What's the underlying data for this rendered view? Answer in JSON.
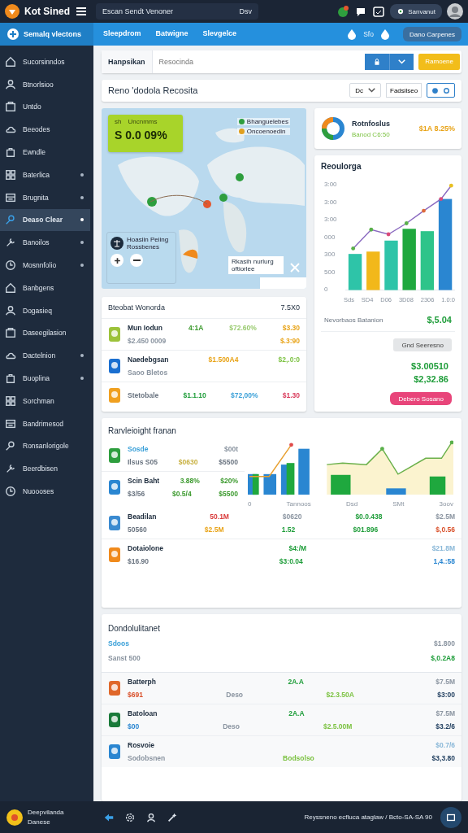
{
  "topbar": {
    "app_name": "Kot Sined",
    "search_text": "Escan Sendt Venoner",
    "search_badge": "Dsv",
    "account_button": "Sanvanut"
  },
  "navbar": {
    "workspace": "Semalq vlectons",
    "tabs": [
      {
        "label": "Sleepdrom",
        "selected": false
      },
      {
        "label": "Batwigne",
        "selected": false
      },
      {
        "label": "Slevgelce",
        "selected": false
      }
    ],
    "count": "Sfo",
    "action_button": "Dano Carpenes"
  },
  "sidebar": {
    "items": [
      {
        "label": "Sucorsinndos",
        "selected": false,
        "expandable": false
      },
      {
        "label": "Btnorlsioo",
        "selected": false,
        "expandable": false
      },
      {
        "label": "Untdo",
        "selected": false,
        "expandable": false
      },
      {
        "label": "Beeodes",
        "selected": false,
        "expandable": false
      },
      {
        "label": "Ewndle",
        "selected": false,
        "expandable": false
      },
      {
        "label": "Baterlica",
        "selected": false,
        "expandable": true
      },
      {
        "label": "Brugnita",
        "selected": false,
        "expandable": true
      },
      {
        "label": "Deaso Clear",
        "selected": true,
        "expandable": true
      },
      {
        "label": "Banoilos",
        "selected": false,
        "expandable": true
      },
      {
        "label": "Mosnnfolio",
        "selected": false,
        "expandable": true
      },
      {
        "label": "Banbgens",
        "selected": false,
        "expandable": false
      },
      {
        "label": "Dogasieq",
        "selected": false,
        "expandable": false
      },
      {
        "label": "Daseegilasion",
        "selected": false,
        "expandable": false
      },
      {
        "label": "Dactelnion",
        "selected": false,
        "expandable": true
      },
      {
        "label": "Buoplina",
        "selected": false,
        "expandable": true
      },
      {
        "label": "Sorchman",
        "selected": false,
        "expandable": false
      },
      {
        "label": "Bandrimesod",
        "selected": false,
        "expandable": false
      },
      {
        "label": "Ronsanlorigole",
        "selected": false,
        "expandable": false
      },
      {
        "label": "Beerdbisen",
        "selected": false,
        "expandable": false
      },
      {
        "label": "Nuoooses",
        "selected": false,
        "expandable": false
      }
    ]
  },
  "filter_bar": {
    "label": "Hanpsikan",
    "search_placeholder": "Resocinda",
    "primary_button": "Ramoene"
  },
  "overview": {
    "title": "Reno 'dodola Recosita",
    "period_dropdown": "Dc",
    "filter_field": "Fadsilseo",
    "view_toggle": [
      {
        "selected": true
      },
      {
        "selected": false
      }
    ]
  },
  "map": {
    "kpi": {
      "label": "sh",
      "sublabel": "Uncnmms",
      "value": "S 0.0 09%"
    },
    "legend": [
      {
        "label": "Bhanguelebes",
        "color": "#2e9e3e"
      },
      {
        "label": "Oncoenoedin",
        "color": "#e0a020"
      }
    ],
    "info_lines": [
      "Hoasiin Peiing",
      "Rossbenes"
    ],
    "note": "Rkasih nurlurg oftiorlee"
  },
  "donut_card": {
    "title": "Rotnfoslus",
    "subtitle": "Banod C6:50",
    "value": "$1A 8.25%"
  },
  "revenue_card": {
    "title": "Reoulorga",
    "y_labels": [
      "3:00",
      "3:00",
      "3:00",
      "000",
      "300",
      "500",
      "0"
    ],
    "x_labels": [
      "Sds",
      "SD4",
      "D06",
      "3D08",
      "2306",
      "1.0:0"
    ],
    "summary_label": "Nevorbaos Batanion",
    "summary_value": "$,5.04",
    "secondary_button": "Gnd Seeresno",
    "values": [
      "$3.00510",
      "$2,32.86"
    ],
    "pink_button": "Debero Sosano"
  },
  "list_card": {
    "title": "Bteobat Wonorda",
    "total": "7.5X0",
    "rows": [
      {
        "lines": [
          [
            {
              "text": "Mun Iodun",
              "color": "#1c2b3c"
            },
            {
              "text": "4:1A",
              "color": "#3c9a2e"
            },
            {
              "text": "$72.60%",
              "color": "#9acb70"
            },
            {
              "text": "$3.30",
              "color": "#e8a317"
            }
          ],
          [
            {
              "text": "$2.450 0009",
              "color": "#8a94a0"
            },
            {
              "text": "$.3:90",
              "color": "#e8a317"
            }
          ]
        ]
      },
      {
        "lines": [
          [
            {
              "text": "Naedebgsan",
              "color": "#1c2b3c"
            },
            {
              "text": "$1.500A4",
              "color": "#e8a317"
            },
            {
              "text": "$2,.0:0",
              "color": "#7cc242"
            }
          ],
          [
            {
              "text": "Saoo Bletos",
              "color": "#8a94a0"
            }
          ]
        ]
      },
      {
        "lines": [
          [
            {
              "text": "Stetobale",
              "color": "#6a7480"
            },
            {
              "text": "$1.1.10",
              "color": "#1f9d3a"
            },
            {
              "text": "$72,00%",
              "color": "#3aa0d8"
            },
            {
              "text": "$1.30",
              "color": "#d93a5a"
            }
          ]
        ]
      }
    ]
  },
  "trend_card": {
    "title": "Rarvleioight franan",
    "x_labels": [
      "0",
      "Tannoos",
      "Dsd",
      "SMt",
      "3oov"
    ],
    "side_rows": [
      {
        "lines": [
          [
            {
              "text": "Sosde",
              "color": "#3aa0d8"
            },
            {
              "text": "$00t",
              "color": "#8a94a0"
            }
          ],
          [
            {
              "text": "Ilsus S05",
              "color": "#6a7480"
            },
            {
              "text": "$0630",
              "color": "#c8b040"
            },
            {
              "text": "$5500",
              "color": "#6a7480"
            }
          ]
        ]
      },
      {
        "lines": [
          [
            {
              "text": "Scin Baht",
              "color": "#1c2b3c"
            },
            {
              "text": "3.88%",
              "color": "#3c9a2e"
            },
            {
              "text": "$20%",
              "color": "#3c9a2e"
            }
          ],
          [
            {
              "text": "$3/56",
              "color": "#6a7480"
            },
            {
              "text": "$0.5/4",
              "color": "#3c9a2e"
            },
            {
              "text": "$5500",
              "color": "#3c9a2e"
            }
          ]
        ]
      }
    ],
    "rows": [
      {
        "lines": [
          [
            {
              "text": "Beadilan",
              "color": "#1c2b3c"
            },
            {
              "text": "50.1M",
              "color": "#d93a3a"
            },
            {
              "text": "$0620",
              "color": "#8a94a0"
            },
            {
              "text": "$0.0.438",
              "color": "#1f9d3a"
            },
            {
              "text": "$2.5M",
              "color": "#8a94a0"
            }
          ],
          [
            {
              "text": "50560",
              "color": "#6a7480"
            },
            {
              "text": "$2.5M",
              "color": "#e8a317"
            },
            {
              "text": "1.52",
              "color": "#1f9d3a"
            },
            {
              "text": "$01.896",
              "color": "#1f9d3a"
            },
            {
              "text": "$,0.56",
              "color": "#d9502a"
            }
          ]
        ]
      },
      {
        "lines": [
          [
            {
              "text": "Dotaiolone",
              "color": "#1c2b3c"
            },
            {
              "text": "$4:/M",
              "color": "#1f9d3a"
            },
            {
              "text": "$21.8M",
              "color": "#8ab8d8"
            }
          ],
          [
            {
              "text": "$16.90",
              "color": "#6a7480"
            },
            {
              "text": "$3:0.04",
              "color": "#1f9d3a"
            },
            {
              "text": "1,4.:58",
              "color": "#2a86d1"
            }
          ]
        ]
      }
    ]
  },
  "holdings_card": {
    "title": "Dondolulitanet",
    "header_lines": [
      [
        {
          "text": "Sdoos",
          "color": "#3aa0d8"
        },
        {
          "text": "$1.800",
          "color": "#8a94a0"
        }
      ],
      [
        {
          "text": "Sanst 500",
          "color": "#8a94a0"
        },
        {
          "text": "$,0.2A8",
          "color": "#1f9d3a"
        }
      ]
    ],
    "rows": [
      {
        "lines": [
          [
            {
              "text": "Batterph",
              "color": "#1c2b3c"
            },
            {
              "text": "2A.A",
              "color": "#1f9d3a"
            },
            {
              "text": "$7.5M",
              "color": "#8a94a0"
            }
          ],
          [
            {
              "text": "$691",
              "color": "#d9502a"
            },
            {
              "text": "Deso",
              "color": "#8a94a0"
            },
            {
              "text": "$2.3.50A",
              "color": "#7cc242"
            },
            {
              "text": "$3:00",
              "color": "#1c3b5c"
            }
          ]
        ]
      },
      {
        "lines": [
          [
            {
              "text": "Batoloan",
              "color": "#1c2b3c"
            },
            {
              "text": "2A.A",
              "color": "#1f9d3a"
            },
            {
              "text": "$7.5M",
              "color": "#8a94a0"
            }
          ],
          [
            {
              "text": "$00",
              "color": "#2a86d1"
            },
            {
              "text": "Deso",
              "color": "#8a94a0"
            },
            {
              "text": "$2.5.00M",
              "color": "#7cc242"
            },
            {
              "text": "$3.2/6",
              "color": "#1c3b5c"
            }
          ]
        ]
      },
      {
        "lines": [
          [
            {
              "text": "Rosvoie",
              "color": "#1c2b3c"
            },
            {
              "text": "$0.7/6",
              "color": "#8ab8d8"
            }
          ],
          [
            {
              "text": "Sodobsnen",
              "color": "#8a94a0"
            },
            {
              "text": "Bodsolso",
              "color": "#7cc242"
            },
            {
              "text": "$3,3.80",
              "color": "#1c3b5c"
            }
          ]
        ]
      }
    ]
  },
  "footer": {
    "user_name": "Deepvilanda",
    "user_role": "Danese",
    "status_text": "Reyssneno ecfluca ataglaw / Bcto-SA-SA 90"
  }
}
